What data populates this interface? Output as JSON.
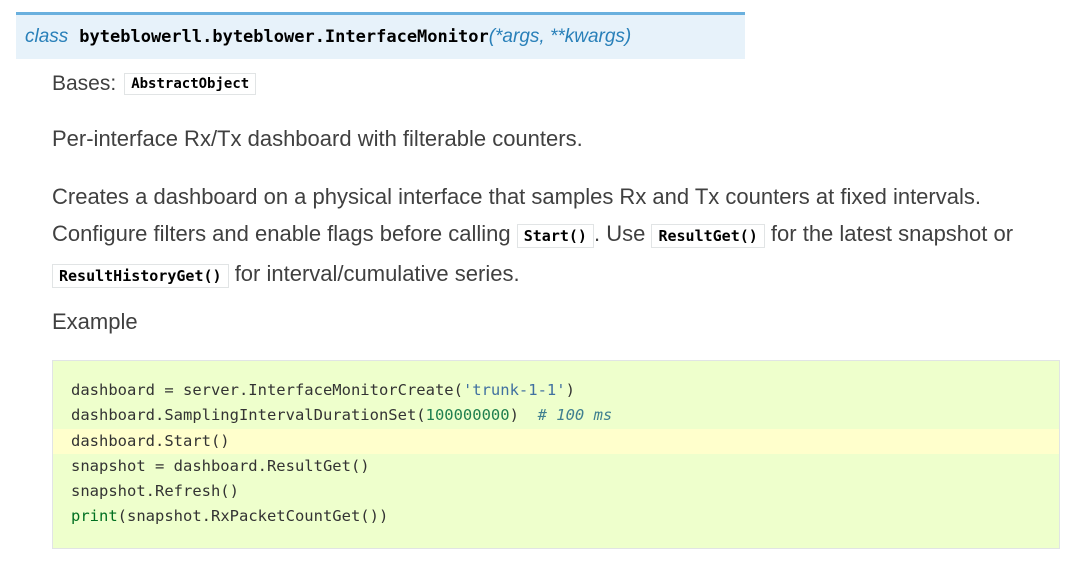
{
  "signature": {
    "keyword": "class",
    "name": "byteblowerll.byteblower.InterfaceMonitor",
    "params": "(*args, **kwargs)"
  },
  "bases": {
    "label": "Bases:",
    "class_name": "AbstractObject"
  },
  "summary": "Per-interface Rx/Tx dashboard with filterable counters.",
  "description": {
    "part1": "Creates a dashboard on a physical interface that samples Rx and Tx counters at fixed intervals. Configure filters and enable flags before calling",
    "code1": "Start()",
    "part2": ". Use",
    "code2": "ResultGet()",
    "part3": "for the latest snapshot or",
    "code3": "ResultHistoryGet()",
    "part4": "for interval/cumulative series."
  },
  "example_heading": "Example",
  "code": {
    "line1": {
      "a": "dashboard = server.InterfaceMonitorCreate(",
      "str": "'trunk-1-1'",
      "b": ")"
    },
    "line2": {
      "a": "dashboard.SamplingIntervalDurationSet(",
      "num": "100000000",
      "b": ")  ",
      "comment": "# 100 ms"
    },
    "line3": {
      "a": "dashboard.Start()"
    },
    "line4": {
      "a": "snapshot = dashboard.ResultGet()"
    },
    "line5": {
      "a": "snapshot.Refresh()"
    },
    "line6": {
      "builtin": "print",
      "a": "(snapshot.RxPacketCountGet())"
    }
  },
  "colors": {
    "signature_bg": "#e7f2fa",
    "signature_border": "#6ab0de",
    "code_bg": "#eeffcc",
    "code_highlight": "#ffffcc"
  }
}
